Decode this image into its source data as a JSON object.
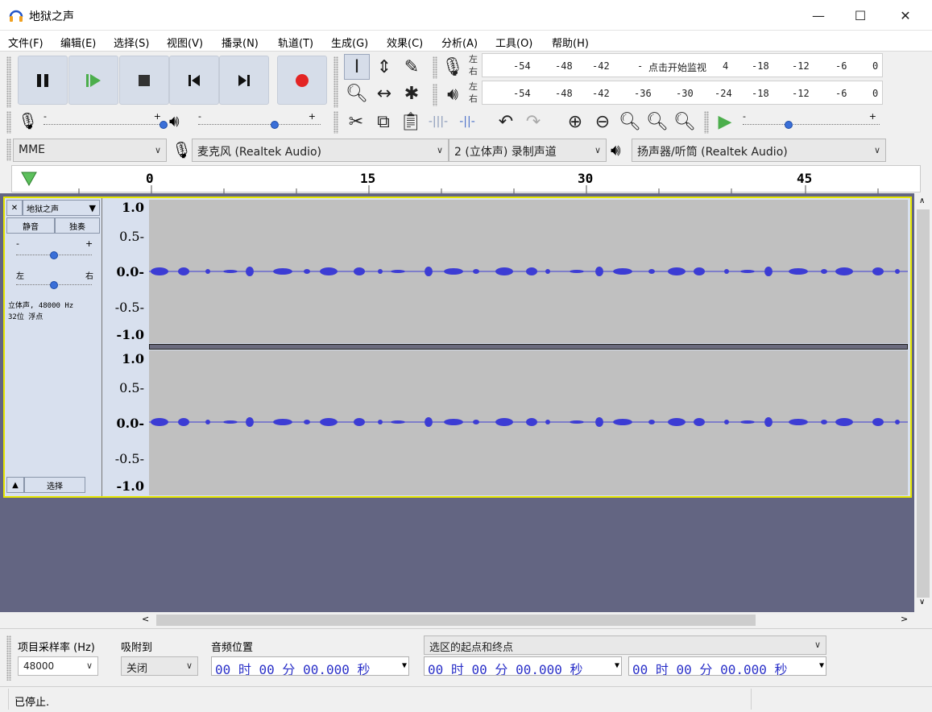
{
  "window": {
    "title": "地狱之声",
    "minimize": "—",
    "maximize": "☐",
    "close": "✕"
  },
  "menu": [
    "文件(F)",
    "编辑(E)",
    "选择(S)",
    "视图(V)",
    "播录(N)",
    "轨道(T)",
    "生成(G)",
    "效果(C)",
    "分析(A)",
    "工具(O)",
    "帮助(H)"
  ],
  "meters": {
    "record_ticks": [
      "-54",
      "-48",
      "-42",
      "-",
      "点击开始监视",
      "4",
      "-18",
      "-12",
      "-6",
      "0"
    ],
    "play_ticks": [
      "-54",
      "-48",
      "-42",
      "-36",
      "-30",
      "-24",
      "-18",
      "-12",
      "-6",
      "0"
    ],
    "left": "左",
    "right": "右"
  },
  "devices": {
    "host": "MME",
    "mic": "麦克风 (Realtek Audio)",
    "channels": "2 (立体声) 录制声道",
    "speaker": "扬声器/听筒 (Realtek Audio)"
  },
  "ruler": {
    "labels": [
      "0",
      "15",
      "30",
      "45"
    ]
  },
  "track": {
    "name": "地狱之声",
    "mute": "静音",
    "solo": "独奏",
    "gain_minus": "-",
    "gain_plus": "+",
    "pan_left": "左",
    "pan_right": "右",
    "info_line1": "立体声, 48000 Hz",
    "info_line2": "32位 浮点",
    "select": "选择",
    "scale": [
      "1.0",
      "0.5-",
      "0.0-",
      "-0.5-",
      "-1.0"
    ]
  },
  "bottom": {
    "rate_label": "项目采样率 (Hz)",
    "rate_value": "48000",
    "snap_label": "吸附到",
    "snap_value": "关闭",
    "pos_label": "音频位置",
    "pos_value": "00 时 00 分 00.000 秒",
    "sel_label": "选区的起点和终点",
    "sel_start": "00 时 00 分 00.000 秒",
    "sel_end": "00 时 00 分 00.000 秒"
  },
  "status": {
    "text": "已停止."
  },
  "colors": {
    "wave": "#3c3cd4",
    "track_bg": "#c0c0c0",
    "selection_border": "#e6e600",
    "empty_area": "#636582"
  }
}
